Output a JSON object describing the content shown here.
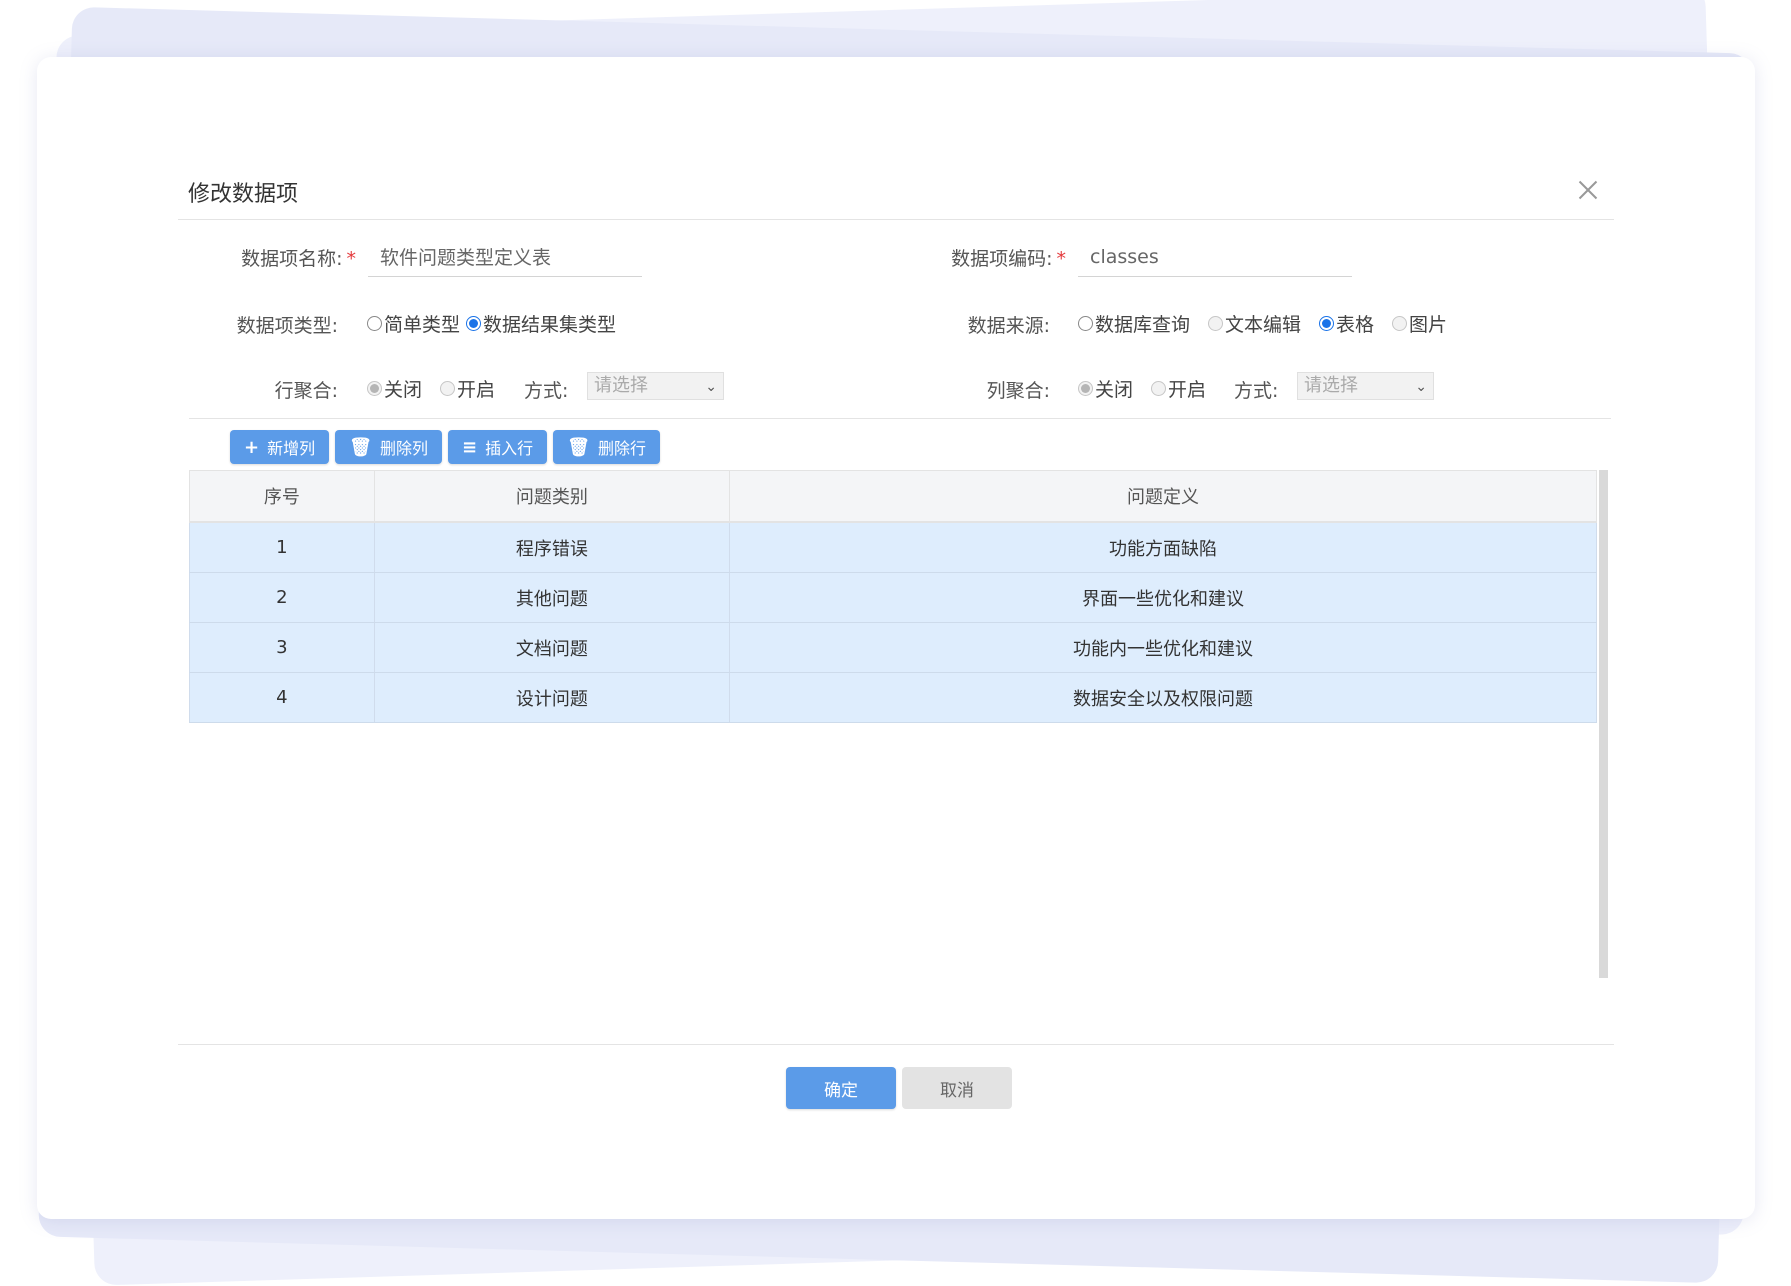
{
  "dialog": {
    "title": "修改数据项"
  },
  "form": {
    "name_label": "数据项名称:",
    "name_value": "软件问题类型定义表",
    "code_label": "数据项编码:",
    "code_value": "classes",
    "required_mark": "*",
    "type_label": "数据项类型:",
    "type_options": [
      {
        "label": "简单类型",
        "checked": false
      },
      {
        "label": "数据结果集类型",
        "checked": true
      }
    ],
    "source_label": "数据来源:",
    "source_options": [
      {
        "label": "数据库查询",
        "checked": false
      },
      {
        "label": "文本编辑",
        "checked": false
      },
      {
        "label": "表格",
        "checked": true
      },
      {
        "label": "图片",
        "checked": false
      }
    ],
    "row_merge_label": "行聚合:",
    "row_merge_options": [
      {
        "label": "关闭",
        "checked": true
      },
      {
        "label": "开启",
        "checked": false
      }
    ],
    "row_mode_label": "方式:",
    "row_mode_placeholder": "请选择",
    "col_merge_label": "列聚合:",
    "col_merge_options": [
      {
        "label": "关闭",
        "checked": true
      },
      {
        "label": "开启",
        "checked": false
      }
    ],
    "col_mode_label": "方式:",
    "col_mode_placeholder": "请选择"
  },
  "toolbar": {
    "add_col": "新增列",
    "del_col": "删除列",
    "insert_row": "插入行",
    "del_row": "删除行"
  },
  "table": {
    "headers": [
      "序号",
      "问题类别",
      "问题定义"
    ],
    "rows": [
      [
        "1",
        "程序错误",
        "功能方面缺陷"
      ],
      [
        "2",
        "其他问题",
        "界面一些优化和建议"
      ],
      [
        "3",
        "文档问题",
        "功能内一些优化和建议"
      ],
      [
        "4",
        "设计问题",
        "数据安全以及权限问题"
      ]
    ]
  },
  "footer": {
    "ok": "确定",
    "cancel": "取消"
  },
  "colors": {
    "primary": "#5b9be8",
    "row_highlight": "#deedfd",
    "required": "#e4393c"
  }
}
